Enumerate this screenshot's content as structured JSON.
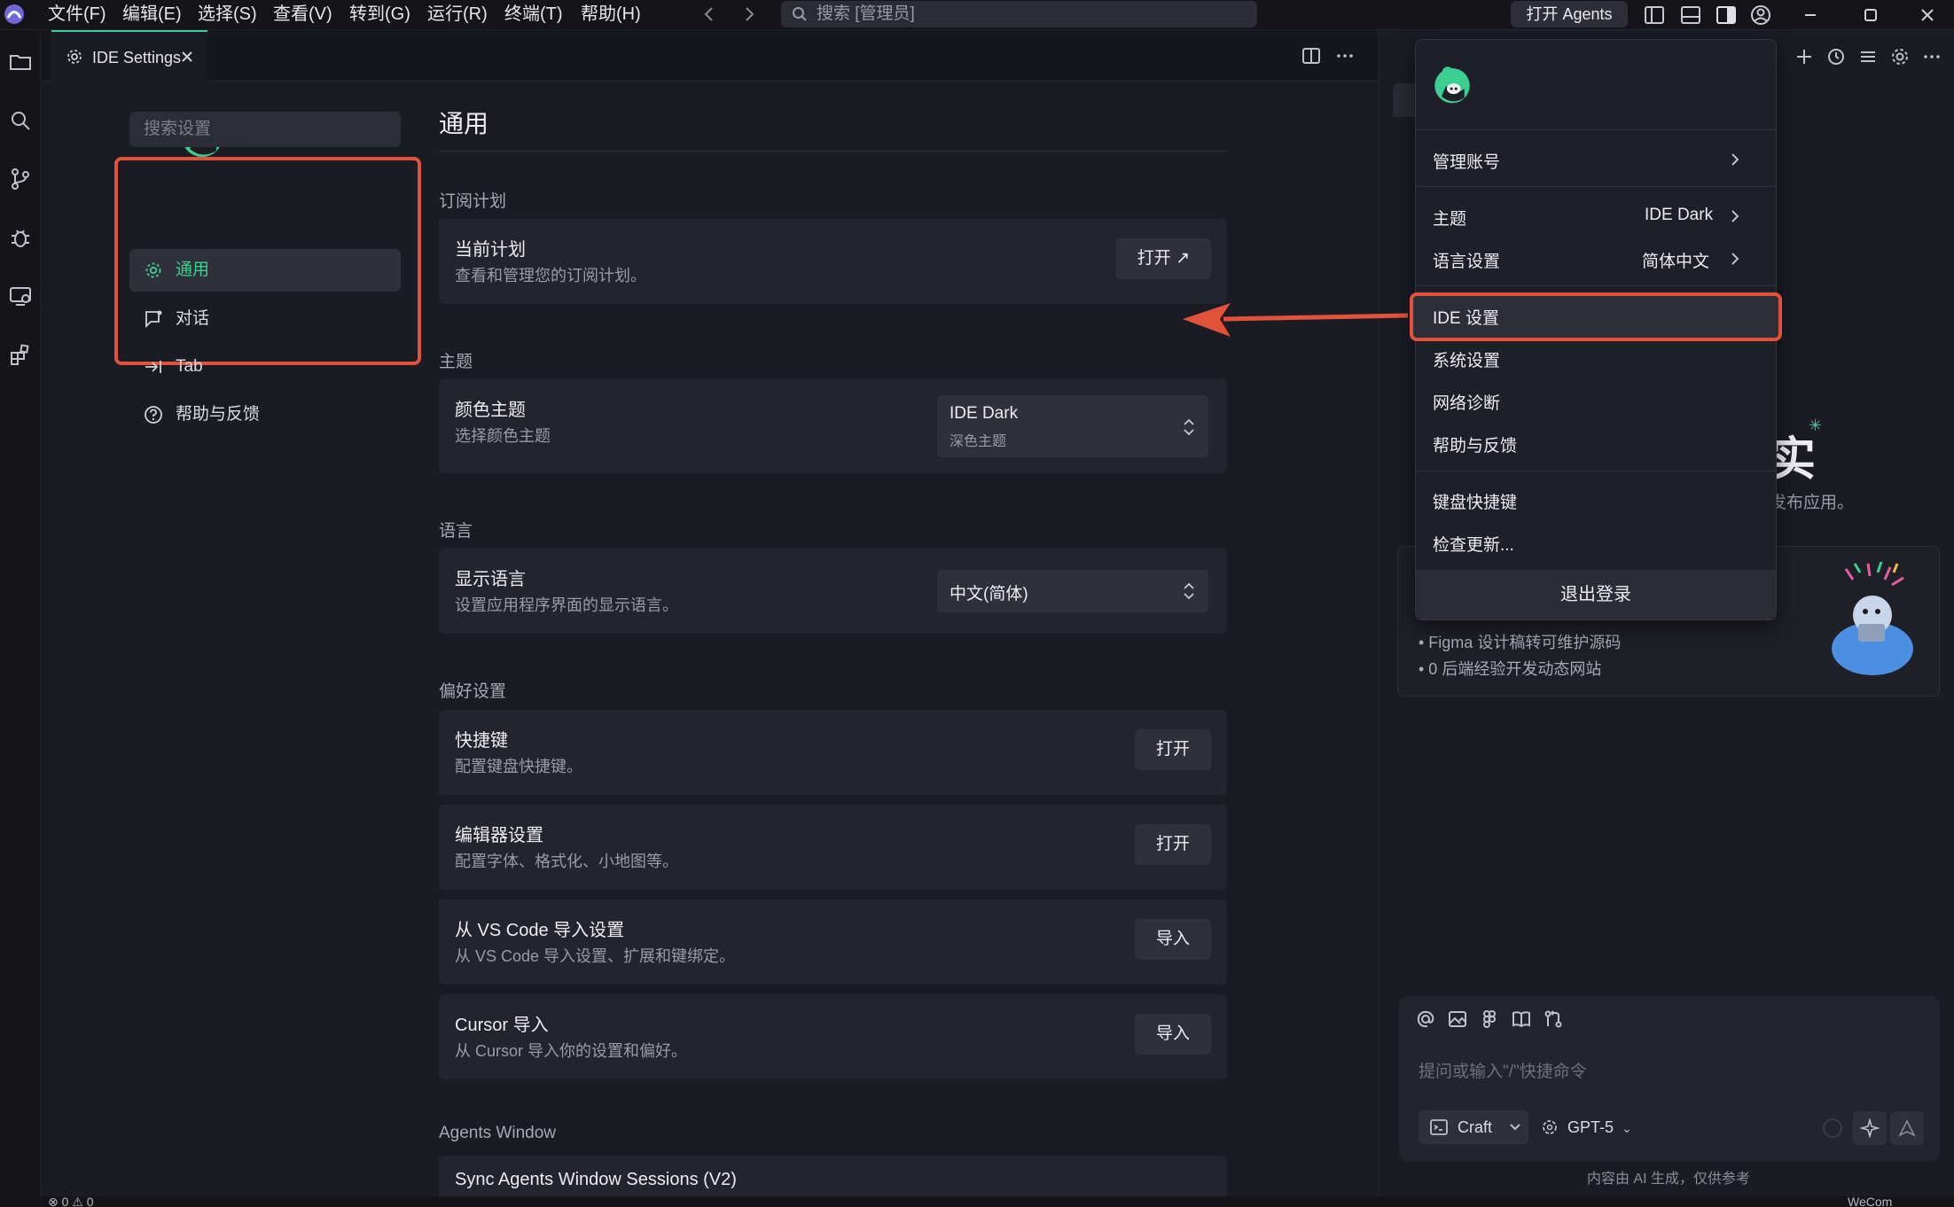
{
  "menubar": {
    "items": [
      "文件(F)",
      "编辑(E)",
      "选择(S)",
      "查看(V)",
      "转到(G)",
      "运行(R)",
      "终端(T)",
      "帮助(H)"
    ],
    "search_placeholder": "搜索 [管理员]",
    "open_agents_label": "打开 Agents"
  },
  "tabs": {
    "active_label": "IDE Settings"
  },
  "settings": {
    "search_placeholder": "搜索设置",
    "nav": [
      {
        "label": "通用",
        "icon": "gear-icon",
        "active": true
      },
      {
        "label": "对话",
        "icon": "chat-icon",
        "active": false
      },
      {
        "label": "Tab",
        "icon": "tab-arrow-icon",
        "active": false
      },
      {
        "label": "帮助与反馈",
        "icon": "help-icon",
        "active": false
      }
    ],
    "page_title": "通用",
    "sections": {
      "subscription": "订阅计划",
      "theme": "主题",
      "language": "语言",
      "preferences": "偏好设置",
      "agents_window": "Agents Window"
    },
    "cards": {
      "plan": {
        "title": "当前计划",
        "desc": "查看和管理您的订阅计划。",
        "button": "打开 ↗"
      },
      "color_theme": {
        "title": "颜色主题",
        "desc": "选择颜色主题",
        "value": "IDE Dark",
        "value_sub": "深色主题"
      },
      "display_lang": {
        "title": "显示语言",
        "desc": "设置应用程序界面的显示语言。",
        "value": "中文(简体)"
      },
      "shortcuts": {
        "title": "快捷键",
        "desc": "配置键盘快捷键。",
        "button": "打开"
      },
      "editor": {
        "title": "编辑器设置",
        "desc": "配置字体、格式化、小地图等。",
        "button": "打开"
      },
      "vscode_import": {
        "title": "从 VS Code 导入设置",
        "desc": "从 VS Code 导入设置、扩展和键绑定。",
        "button": "导入"
      },
      "cursor_import": {
        "title": "Cursor 导入",
        "desc": "从 Cursor 导入你的设置和偏好。",
        "button": "导入"
      },
      "sync_agents": {
        "title": "Sync Agents Window Sessions (V2)"
      }
    }
  },
  "right_panel": {
    "hero_char": "实",
    "hero_sub": "发布应用。",
    "features": [
      "• Figma 设计稿转可维护源码",
      "• 0 后端经验开发动态网站"
    ],
    "chat_placeholder": "提问或输入\"/\"快捷命令",
    "mode": "Craft",
    "model": "GPT-5",
    "disclaimer": "内容由 AI 生成，仅供参考"
  },
  "dropdown": {
    "manage_account": "管理账号",
    "theme_label": "主题",
    "theme_value": "IDE Dark",
    "language_label": "语言设置",
    "language_value": "简体中文",
    "ide_settings": "IDE 设置",
    "system_settings": "系统设置",
    "network_diag": "网络诊断",
    "help_feedback": "帮助与反馈",
    "keyboard_shortcuts": "键盘快捷键",
    "check_updates": "检查更新...",
    "logout": "退出登录"
  },
  "statusbar": {
    "problems": "⊗ 0 ⚠ 0",
    "right": "WeCom"
  },
  "colors": {
    "accent": "#3ccf91",
    "highlight": "#e2513a",
    "background": "#1b1b24"
  }
}
